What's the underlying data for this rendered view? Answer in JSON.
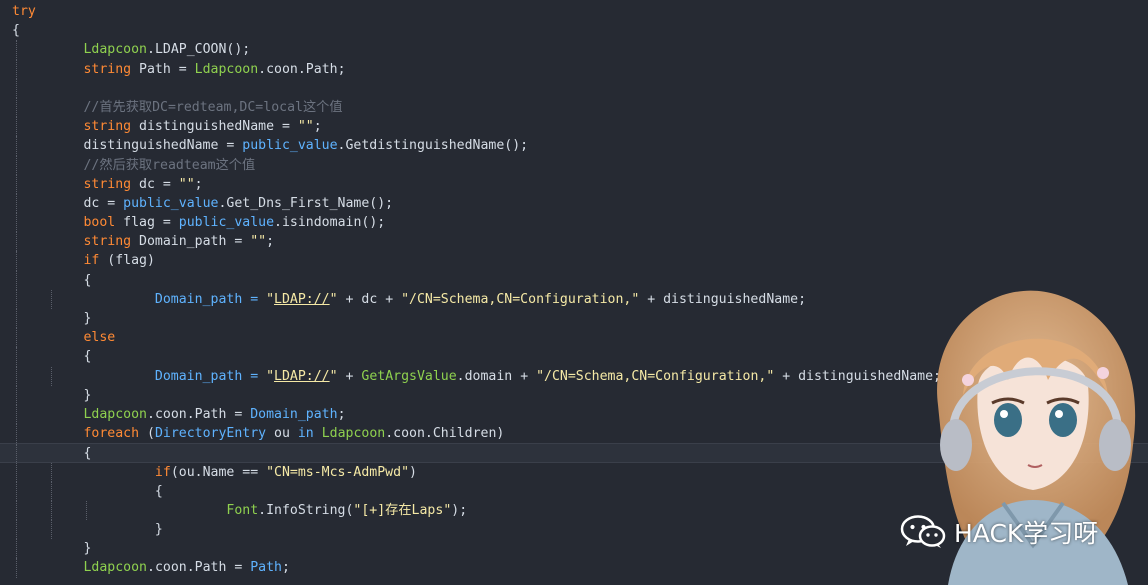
{
  "code": {
    "try": "try",
    "open_brace": "{",
    "close_brace": "}",
    "l1_class": "Ldapcoon",
    "l1_rest": ".LDAP_COON();",
    "l2_type": "string",
    "l2_mid": " Path = ",
    "l2_class": "Ldapcoon",
    "l2_rest": ".coon.Path;",
    "comment1": "//首先获取DC=redteam,DC=local这个值",
    "l4_type": "string",
    "l4_mid": " distinguishedName = ",
    "l4_str": "\"\"",
    "semi": ";",
    "l5_lhs": "distinguishedName = ",
    "l5_usr": "public_value",
    "l5_rest": ".GetdistinguishedName();",
    "comment2": "//然后获取readteam这个值",
    "l7_type": "string",
    "l7_mid": " dc = ",
    "l7_str": "\"\"",
    "l8_lhs": "dc = ",
    "l8_usr": "public_value",
    "l8_rest": ".Get_Dns_First_Name();",
    "l9_type": "bool",
    "l9_mid": " flag = ",
    "l9_usr": "public_value",
    "l9_rest": ".isindomain();",
    "l10_type": "string",
    "l10_mid": " Domain_path = ",
    "l10_str": "\"\"",
    "if": "if",
    "if_cond": " (flag)",
    "dp_lhs": "Domain_path = ",
    "q_open": "\"",
    "ldap": "LDAP://",
    "q_close": "\"",
    "plus_dc": " + dc + ",
    "cn_str": "\"/CN=Schema,CN=Configuration,\"",
    "plus_dn": " + distinguishedName;",
    "else": "else",
    "plus_sp": " + ",
    "getargs": "GetArgsValue",
    "domain_plus": ".domain + ",
    "assign_class": "Ldapcoon",
    "assign_mid": ".coon.Path = ",
    "assign_usr": "Domain_path",
    "foreach": "foreach",
    "fe_paren": " (",
    "fe_type": "DirectoryEntry",
    "fe_ou": " ou ",
    "fe_in": "in",
    "fe_sp": " ",
    "fe_class": "Ldapcoon",
    "fe_rest": ".coon.Children)",
    "if2": "if",
    "if2_cond": "(ou.Name == ",
    "if2_str": "\"CN=ms-Mcs-AdmPwd\"",
    "if2_close": ")",
    "font_class": "Font",
    "font_rest": ".InfoString(",
    "font_str": "\"[+]存在Laps\"",
    "font_close": ");",
    "last_class": "Ldapcoon",
    "last_mid": ".coon.Path = ",
    "last_usr": "Path",
    "last_semi": ";"
  },
  "watermark": {
    "text": "HACK学习呀",
    "icon": "wechat-icon"
  },
  "colors": {
    "background": "#262a33",
    "keyword": "#ff8a35",
    "class": "#8fd14f",
    "string": "#f5e9a6",
    "user_object": "#5fb3ff",
    "comment": "#6c7380"
  }
}
